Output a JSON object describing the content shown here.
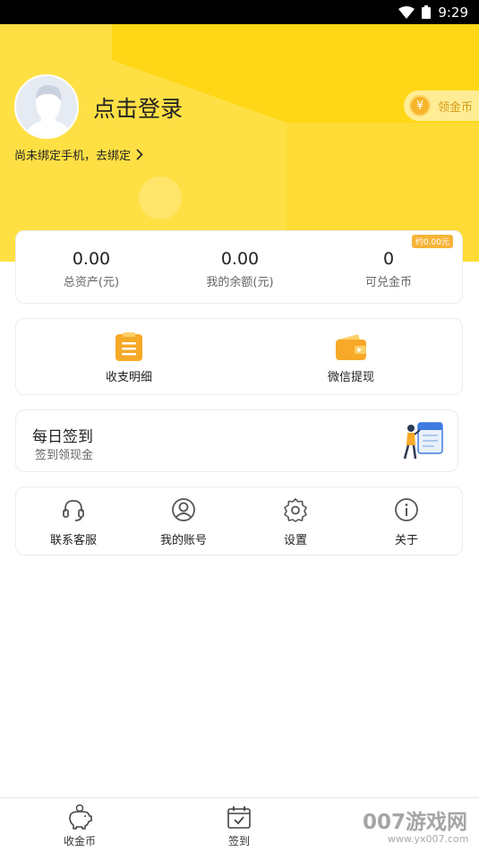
{
  "status_bar": {
    "time": "9:29"
  },
  "profile": {
    "login_text": "点击登录",
    "bind_phone_text": "尚未绑定手机，去绑定",
    "coin_button_label": "领金币",
    "coin_symbol": "¥"
  },
  "stats": {
    "items": [
      {
        "value": "0.00",
        "label": "总资产(元)"
      },
      {
        "value": "0.00",
        "label": "我的余额(元)"
      },
      {
        "value": "0",
        "label": "可兑金币"
      }
    ],
    "badge": "约0.00元"
  },
  "wallet_menu": {
    "items": [
      {
        "label": "收支明细",
        "icon": "list-icon"
      },
      {
        "label": "微信提现",
        "icon": "wallet-icon"
      }
    ]
  },
  "daily_signin": {
    "title": "每日签到",
    "subtitle": "签到领现金"
  },
  "service_menu": {
    "items": [
      {
        "label": "联系客服",
        "icon": "headset-icon"
      },
      {
        "label": "我的账号",
        "icon": "user-circle-icon"
      },
      {
        "label": "设置",
        "icon": "gear-icon"
      },
      {
        "label": "关于",
        "icon": "info-icon"
      }
    ]
  },
  "tab_bar": {
    "items": [
      {
        "label": "收金币",
        "icon": "piggy-bank-icon"
      },
      {
        "label": "签到",
        "icon": "calendar-check-icon"
      }
    ]
  },
  "watermark": {
    "line1": "007游戏网",
    "line2": "www.yx007.com"
  },
  "colors": {
    "accent": "#ffd717",
    "coin": "#f6b52a",
    "icon_orange": "#f7a928"
  }
}
